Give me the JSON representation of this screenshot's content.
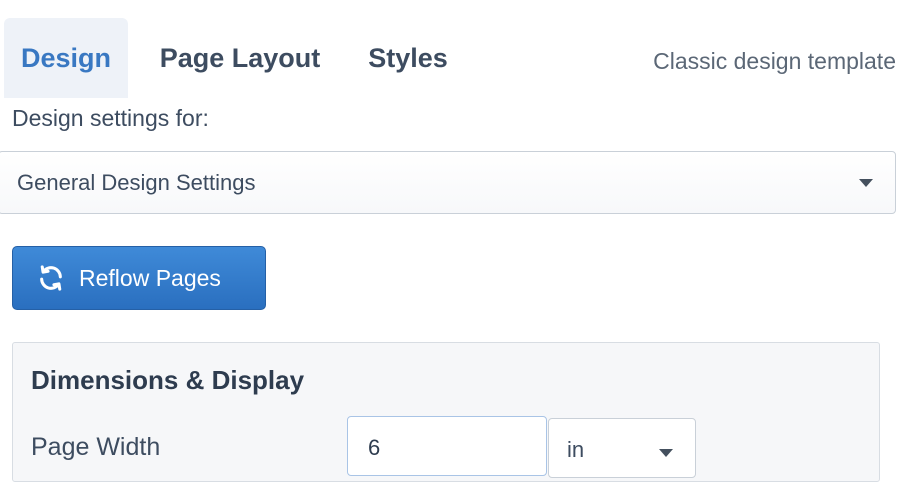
{
  "tabs": [
    {
      "label": "Design",
      "active": true
    },
    {
      "label": "Page Layout",
      "active": false
    },
    {
      "label": "Styles",
      "active": false
    }
  ],
  "template_name": "Classic design template",
  "settings_for": {
    "label": "Design settings for:",
    "selected": "General Design Settings"
  },
  "reflow_button": {
    "label": "Reflow Pages",
    "icon": "refresh-icon"
  },
  "dimensions_panel": {
    "title": "Dimensions & Display",
    "page_width": {
      "label": "Page Width",
      "value": "6",
      "unit": "in"
    }
  },
  "colors": {
    "accent": "#3978c2",
    "button": "#2f78c8",
    "text": "#3d4c60"
  }
}
